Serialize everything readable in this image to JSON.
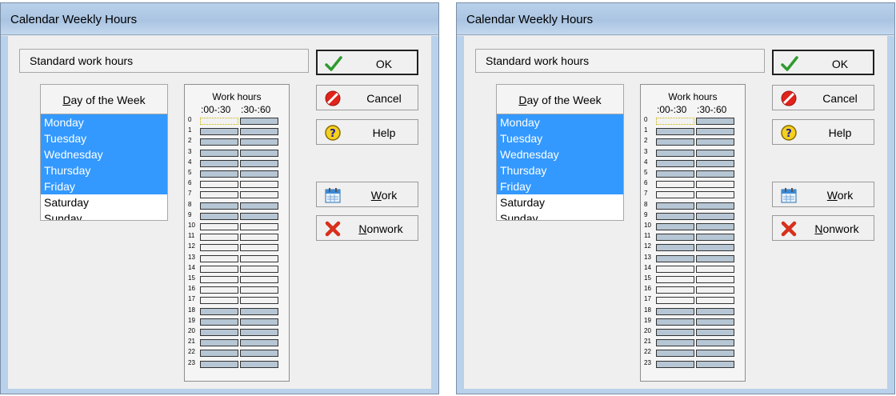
{
  "dialogs": [
    {
      "title": "Calendar Weekly Hours",
      "section_header": "Standard work hours",
      "day_of_week_header": "Day of the Week",
      "day_of_week_underline": "D",
      "day_of_week_rest": "ay of the Week",
      "days": [
        {
          "label": "Monday",
          "selected": true
        },
        {
          "label": "Tuesday",
          "selected": true
        },
        {
          "label": "Wednesday",
          "selected": true
        },
        {
          "label": "Thursday",
          "selected": true
        },
        {
          "label": "Friday",
          "selected": true
        },
        {
          "label": "Saturday",
          "selected": false
        },
        {
          "label": "Sunday",
          "selected": false
        }
      ],
      "work_hours": {
        "title": "Work hours",
        "col1": ":00-:30",
        "col2": ":30-:60",
        "hours": [
          "0",
          "1",
          "2",
          "3",
          "4",
          "5",
          "6",
          "7",
          "8",
          "9",
          "10",
          "11",
          "12",
          "13",
          "14",
          "15",
          "16",
          "17",
          "18",
          "19",
          "20",
          "21",
          "22",
          "23"
        ],
        "nonwork_hours": [
          6,
          7,
          10,
          11,
          12,
          13,
          14,
          15,
          16,
          17
        ]
      },
      "buttons": {
        "ok": "OK",
        "cancel": "Cancel",
        "help": "Help",
        "work_u": "W",
        "work_rest": "ork",
        "nonwork_u": "N",
        "nonwork_rest": "onwork"
      }
    },
    {
      "title": "Calendar Weekly Hours",
      "section_header": "Standard work hours",
      "day_of_week_header": "Day of the Week",
      "day_of_week_underline": "D",
      "day_of_week_rest": "ay of the Week",
      "days": [
        {
          "label": "Monday",
          "selected": true
        },
        {
          "label": "Tuesday",
          "selected": true
        },
        {
          "label": "Wednesday",
          "selected": true
        },
        {
          "label": "Thursday",
          "selected": true
        },
        {
          "label": "Friday",
          "selected": true
        },
        {
          "label": "Saturday",
          "selected": false
        },
        {
          "label": "Sunday",
          "selected": false
        }
      ],
      "work_hours": {
        "title": "Work hours",
        "col1": ":00-:30",
        "col2": ":30-:60",
        "hours": [
          "0",
          "1",
          "2",
          "3",
          "4",
          "5",
          "6",
          "7",
          "8",
          "9",
          "10",
          "11",
          "12",
          "13",
          "14",
          "15",
          "16",
          "17",
          "18",
          "19",
          "20",
          "21",
          "22",
          "23"
        ],
        "nonwork_hours": [
          6,
          7,
          14,
          15,
          16,
          17
        ]
      },
      "buttons": {
        "ok": "OK",
        "cancel": "Cancel",
        "help": "Help",
        "work_u": "W",
        "work_rest": "ork",
        "nonwork_u": "N",
        "nonwork_rest": "onwork"
      }
    }
  ],
  "colors": {
    "selection": "#3399ff",
    "work_cell": "#b6c6d4",
    "nonwork_cell": "#f2f2f2",
    "titlebar": "#b9d1ea"
  },
  "icons": {
    "ok": "check-icon",
    "cancel": "cancel-icon",
    "help": "help-icon",
    "work": "calendar-icon",
    "nonwork": "x-icon"
  }
}
